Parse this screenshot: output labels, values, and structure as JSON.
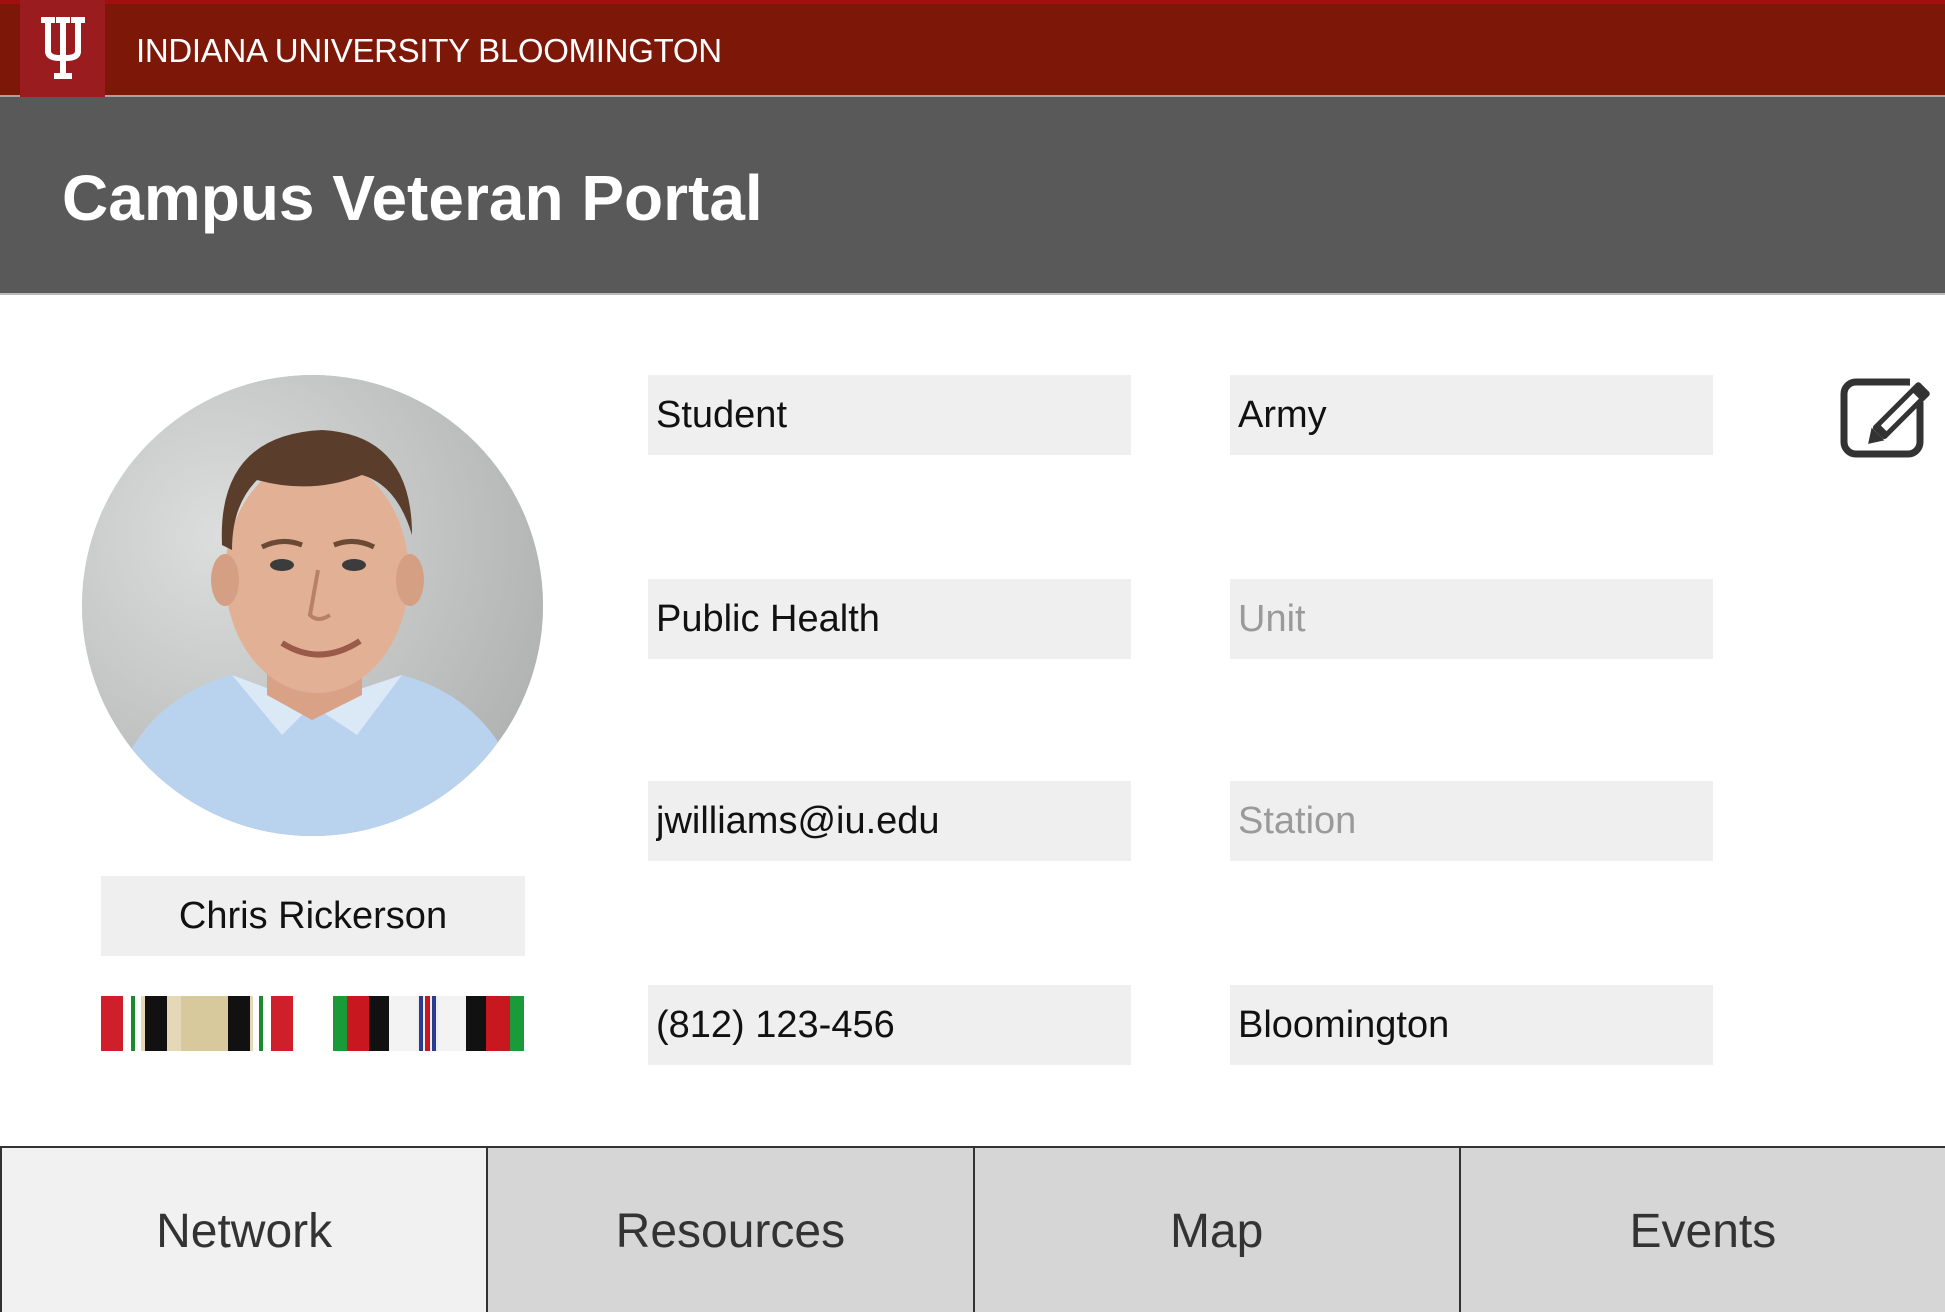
{
  "banner": {
    "university": "INDIANA UNIVERSITY BLOOMINGTON",
    "logo_icon": "iu-trident-icon",
    "color": "#7d1708"
  },
  "header": {
    "title": "Campus Veteran Portal",
    "color": "#595959"
  },
  "profile": {
    "name": "Chris Rickerson",
    "avatar_icon": "profile-photo",
    "ribbons": [
      "service-ribbon-1",
      "service-ribbon-2"
    ],
    "fields": {
      "status": {
        "value": "Student",
        "placeholder": ""
      },
      "branch": {
        "value": "Army",
        "placeholder": ""
      },
      "major": {
        "value": "Public Health",
        "placeholder": ""
      },
      "unit": {
        "value": "",
        "placeholder": "Unit"
      },
      "email": {
        "value": "jwilliams@iu.edu",
        "placeholder": ""
      },
      "station": {
        "value": "",
        "placeholder": "Station"
      },
      "phone": {
        "value": "(812) 123-456",
        "placeholder": ""
      },
      "location": {
        "value": "Bloomington",
        "placeholder": ""
      }
    },
    "edit_icon": "edit-icon"
  },
  "tabs": [
    {
      "label": "Network",
      "active": true
    },
    {
      "label": "Resources",
      "active": false
    },
    {
      "label": "Map",
      "active": false
    },
    {
      "label": "Events",
      "active": false
    }
  ]
}
